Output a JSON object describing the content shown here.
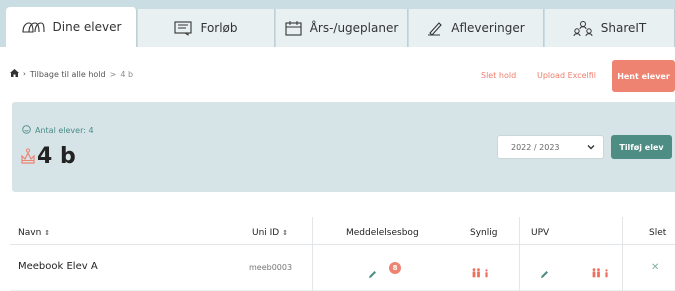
{
  "tabs": [
    {
      "label": "Dine elever",
      "icon": "students-icon",
      "active": true
    },
    {
      "label": "Forløb",
      "icon": "course-icon"
    },
    {
      "label": "Års-/ugeplaner",
      "icon": "calendar-icon"
    },
    {
      "label": "Afleveringer",
      "icon": "pen-icon"
    },
    {
      "label": "ShareIT",
      "icon": "share-people-icon"
    }
  ],
  "breadcrumb": {
    "back_label": "Tilbage til alle hold",
    "separator": ">",
    "current": "4 b"
  },
  "actions": {
    "delete_class": "Slet hold",
    "upload_excel": "Upload Excelfil",
    "fetch_students": "Hent elever"
  },
  "class_card": {
    "student_count_label": "Antal elever: 4",
    "class_name": "4 b",
    "year_selected": "2022 / 2023",
    "add_student": "Tilføj elev"
  },
  "table": {
    "headers": {
      "name": "Navn",
      "uni_id": "Uni ID",
      "message_book": "Meddelelsesbog",
      "visible": "Synlig",
      "upv": "UPV",
      "delete": "Slet"
    },
    "rows": [
      {
        "name": "Meebook Elev A",
        "uni_id": "meeb0003",
        "message_badge": "8"
      }
    ]
  },
  "colors": {
    "accent_coral": "#ef8372",
    "accent_teal": "#4e8d84",
    "card_bg": "#d6e4e7",
    "tabbar_bg": "#c9dde2"
  }
}
